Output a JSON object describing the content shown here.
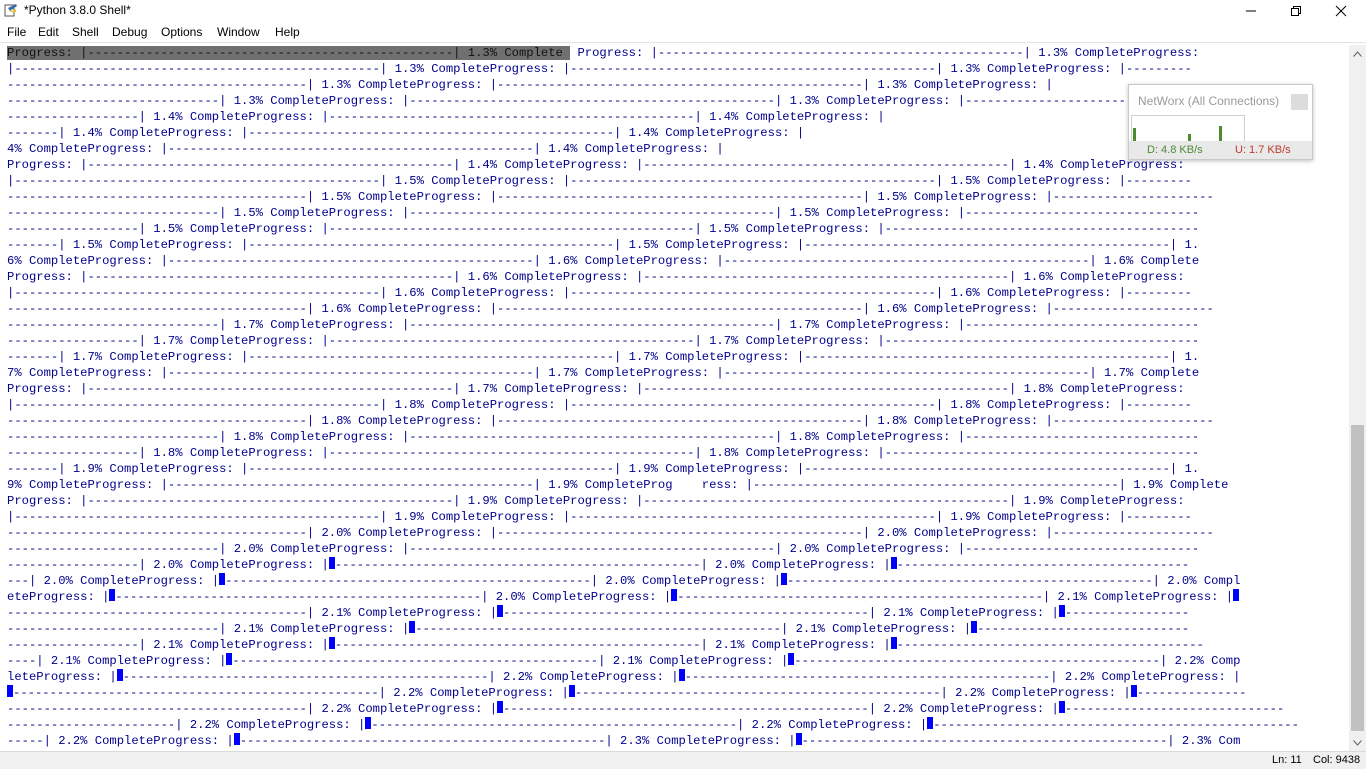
{
  "window": {
    "title": "*Python 3.8.0 Shell*",
    "minimize_glyph": "─",
    "maximize_glyph": "❐",
    "close_glyph": "✕"
  },
  "menu": [
    "File",
    "Edit",
    "Shell",
    "Debug",
    "Options",
    "Window",
    "Help"
  ],
  "console": {
    "highlight_text": "Progress: |--------------------------------------------------| 1.3% Complete ",
    "first_line_rest": " Progress: |--------------------------------------------------| 1.3% CompleteProgress:",
    "lines": [
      "|--------------------------------------------------| 1.3% CompleteProgress: |--------------------------------------------------| 1.3% CompleteProgress: |---------",
      "-----------------------------------------| 1.3% CompleteProgress: |--------------------------------------------------| 1.3% CompleteProgress: |",
      "-----------------------------| 1.3% CompleteProgress: |--------------------------------------------------| 1.3% CompleteProgress: |----------------------",
      "------------------| 1.4% CompleteProgress: |--------------------------------------------------| 1.4% CompleteProgress: |",
      "-------| 1.4% CompleteProgress: |--------------------------------------------------| 1.4% CompleteProgress: |",
      "4% CompleteProgress: |--------------------------------------------------| 1.4% CompleteProgress: |",
      "Progress: |--------------------------------------------------| 1.4% CompleteProgress: |--------------------------------------------------| 1.4% CompleteProgress:",
      "|--------------------------------------------------| 1.5% CompleteProgress: |--------------------------------------------------| 1.5% CompleteProgress: |---------",
      "-----------------------------------------| 1.5% CompleteProgress: |--------------------------------------------------| 1.5% CompleteProgress: |----------------------",
      "-----------------------------| 1.5% CompleteProgress: |--------------------------------------------------| 1.5% CompleteProgress: |--------------------------------",
      "------------------| 1.5% CompleteProgress: |--------------------------------------------------| 1.5% CompleteProgress: |-------------------------------------------",
      "-------| 1.5% CompleteProgress: |--------------------------------------------------| 1.5% CompleteProgress: |--------------------------------------------------| 1.",
      "6% CompleteProgress: |--------------------------------------------------| 1.6% CompleteProgress: |--------------------------------------------------| 1.6% Complete",
      "Progress: |--------------------------------------------------| 1.6% CompleteProgress: |--------------------------------------------------| 1.6% CompleteProgress:",
      "|--------------------------------------------------| 1.6% CompleteProgress: |--------------------------------------------------| 1.6% CompleteProgress: |---------",
      "-----------------------------------------| 1.6% CompleteProgress: |--------------------------------------------------| 1.6% CompleteProgress: |----------------------",
      "-----------------------------| 1.7% CompleteProgress: |--------------------------------------------------| 1.7% CompleteProgress: |--------------------------------",
      "------------------| 1.7% CompleteProgress: |--------------------------------------------------| 1.7% CompleteProgress: |-------------------------------------------",
      "-------| 1.7% CompleteProgress: |--------------------------------------------------| 1.7% CompleteProgress: |--------------------------------------------------| 1.",
      "7% CompleteProgress: |--------------------------------------------------| 1.7% CompleteProgress: |--------------------------------------------------| 1.7% Complete",
      "Progress: |--------------------------------------------------| 1.7% CompleteProgress: |--------------------------------------------------| 1.8% CompleteProgress:",
      "|--------------------------------------------------| 1.8% CompleteProgress: |--------------------------------------------------| 1.8% CompleteProgress: |---------",
      "-----------------------------------------| 1.8% CompleteProgress: |--------------------------------------------------| 1.8% CompleteProgress: |----------------------",
      "-----------------------------| 1.8% CompleteProgress: |--------------------------------------------------| 1.8% CompleteProgress: |--------------------------------",
      "------------------| 1.8% CompleteProgress: |--------------------------------------------------| 1.8% CompleteProgress: |-------------------------------------------",
      "-------| 1.9% CompleteProgress: |--------------------------------------------------| 1.9% CompleteProgress: |--------------------------------------------------| 1.",
      "9% CompleteProgress: |--------------------------------------------------| 1.9% CompleteProg    ress: |--------------------------------------------------| 1.9% Complete",
      "Progress: |--------------------------------------------------| 1.9% CompleteProgress: |--------------------------------------------------| 1.9% CompleteProgress:",
      "|--------------------------------------------------| 1.9% CompleteProgress: |--------------------------------------------------| 1.9% CompleteProgress: |---------",
      "-----------------------------------------| 2.0% CompleteProgress: |--------------------------------------------------| 2.0% CompleteProgress: |----------------------",
      "-----------------------------| 2.0% CompleteProgress: |--------------------------------------------------| 2.0% CompleteProgress: |--------------------------------"
    ],
    "cursor_lines": [
      [
        "------------------| 2.0% CompleteProgress: |",
        "--------------------------------------------------| 2.0% CompleteProgress: |",
        "----------------------------------------"
      ],
      [
        "---| 2.0% CompleteProgress: |",
        "--------------------------------------------------| 2.0% CompleteProgress: |",
        "--------------------------------------------------| 2.0% Compl"
      ],
      [
        "eteProgress: |",
        "--------------------------------------------------| 2.0% CompleteProgress: |",
        "--------------------------------------------------| 2.1% CompleteProgress: |",
        ""
      ],
      [
        "-----------------------------------------| 2.1% CompleteProgress: |",
        "--------------------------------------------------| 2.1% CompleteProgress: |",
        "-----------------"
      ],
      [
        "-----------------------------| 2.1% CompleteProgress: |",
        "--------------------------------------------------| 2.1% CompleteProgress: |",
        "-----------------------------"
      ],
      [
        "------------------| 2.1% CompleteProgress: |",
        "--------------------------------------------------| 2.1% CompleteProgress: |",
        "------------------------------------------"
      ],
      [
        "----| 2.1% CompleteProgress: |",
        "--------------------------------------------------| 2.1% CompleteProgress: |",
        "--------------------------------------------------| 2.2% Comp"
      ],
      [
        "leteProgress: |",
        "--------------------------------------------------| 2.2% CompleteProgress: |",
        "--------------------------------------------------| 2.2% CompleteProgress: |"
      ],
      [
        "",
        "--------------------------------------------------| 2.2% CompleteProgress: |",
        "--------------------------------------------------| 2.2% CompleteProgress: |",
        "---------------"
      ],
      [
        "-----------------------------------------| 2.2% CompleteProgress: |",
        "--------------------------------------------------| 2.2% CompleteProgress: |",
        "------------------------------"
      ],
      [
        "-----------------------| 2.2% CompleteProgress: |",
        "--------------------------------------------------| 2.2% CompleteProgress: |",
        "--------------------------------------------------"
      ],
      [
        "-----| 2.2% CompleteProgress: |",
        "--------------------------------------------------| 2.3% CompleteProgress: |",
        "--------------------------------------------------| 2.3% Com"
      ]
    ]
  },
  "statusbar": {
    "line": "Ln: 11",
    "col": "Col: 9438"
  },
  "networx": {
    "title": "NetWorx (All Connections)",
    "download": "D: 4.8 KB/s",
    "upload": "U: 1.7 KB/s",
    "bar_levels": [
      0.55,
      0.3,
      0.6
    ]
  },
  "colors": {
    "console_text": "#00008b",
    "cursor": "#0000ff",
    "highlight": "#707070"
  }
}
